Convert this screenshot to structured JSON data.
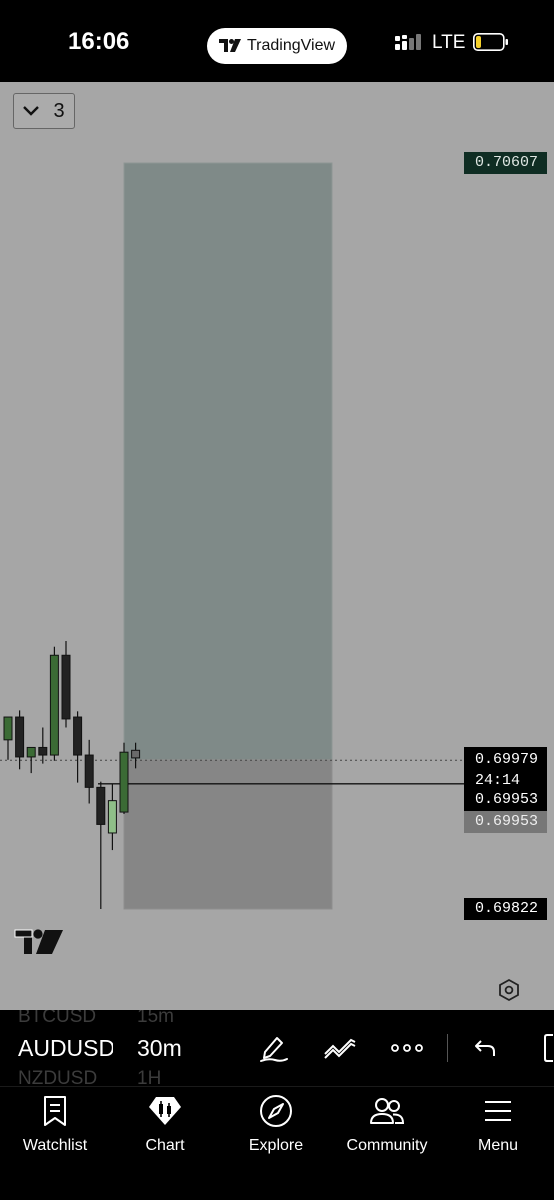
{
  "status_bar": {
    "time": "16:06",
    "app_name": "TradingView",
    "network": "LTE"
  },
  "chart": {
    "layers_count": "3",
    "price_labels": {
      "target": "0.70607",
      "current": "0.69979",
      "countdown": "24:14",
      "bid": "0.69953",
      "ask": "0.69953",
      "stop": "0.69822"
    },
    "chart_data": {
      "type": "candlestick",
      "y_range": [
        0.6982,
        0.7061
      ],
      "position_tool": {
        "target": 0.70607,
        "entry": 0.69979,
        "stop": 0.69822
      },
      "last_price": 0.69979,
      "colors": {
        "up": "#3b6b35",
        "down": "#222222",
        "up_light": "#8fbf88",
        "down_light": "#6a6a6a"
      },
      "candles": [
        {
          "o": 0.7,
          "h": 0.70007,
          "c": 0.70024,
          "l": 0.69979,
          "dir": "up"
        },
        {
          "o": 0.70024,
          "h": 0.70031,
          "c": 0.69982,
          "l": 0.69969,
          "dir": "down"
        },
        {
          "o": 0.69982,
          "h": 0.69989,
          "c": 0.69992,
          "l": 0.69965,
          "dir": "up"
        },
        {
          "o": 0.69992,
          "h": 0.70013,
          "c": 0.69984,
          "l": 0.69975,
          "dir": "down"
        },
        {
          "o": 0.69984,
          "h": 0.70098,
          "c": 0.70089,
          "l": 0.69978,
          "dir": "up"
        },
        {
          "o": 0.70089,
          "h": 0.70104,
          "c": 0.70022,
          "l": 0.70013,
          "dir": "down"
        },
        {
          "o": 0.70024,
          "h": 0.7003,
          "c": 0.69984,
          "l": 0.69955,
          "dir": "down"
        },
        {
          "o": 0.69984,
          "h": 0.7,
          "c": 0.6995,
          "l": 0.69933,
          "dir": "down"
        },
        {
          "o": 0.6995,
          "h": 0.69956,
          "c": 0.69911,
          "l": 0.69822,
          "dir": "down"
        },
        {
          "o": 0.69902,
          "h": 0.69953,
          "c": 0.69936,
          "l": 0.69884,
          "dir": "up_light"
        },
        {
          "o": 0.69924,
          "h": 0.69997,
          "c": 0.69987,
          "l": 0.69922,
          "dir": "up"
        },
        {
          "o": 0.69989,
          "h": 0.69997,
          "c": 0.69981,
          "l": 0.6997,
          "dir": "down_light"
        }
      ]
    }
  },
  "symbol_bar": {
    "symbol_prev": "BTCUSD",
    "interval_prev": "15m",
    "symbol": "AUDUSD",
    "interval": "30m",
    "symbol_next": "NZDUSD",
    "interval_next": "1H"
  },
  "nav": {
    "watchlist": "Watchlist",
    "chart": "Chart",
    "explore": "Explore",
    "community": "Community",
    "menu": "Menu"
  }
}
